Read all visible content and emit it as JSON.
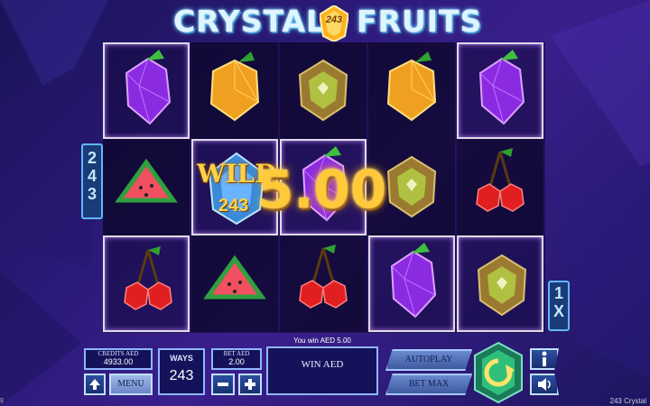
{
  "game": {
    "title_left": "CRYSTAL",
    "title_right": "FRUITS",
    "logo_number": "243",
    "side_ways_label": "243",
    "multiplier_label": "1X",
    "wild_text": "WILD",
    "wild_number": "243",
    "big_win_amount": "5.00",
    "footer_title": "243 Crystal",
    "footer_left": "g"
  },
  "reels": {
    "columns": [
      [
        "plum",
        "watermelon",
        "cherry"
      ],
      [
        "orange",
        "wild",
        "watermelon"
      ],
      [
        "kiwi",
        "plum",
        "cherry"
      ],
      [
        "orange",
        "kiwi",
        "plum"
      ],
      [
        "plum",
        "cherry",
        "kiwi"
      ]
    ],
    "winning_cells": [
      "0-0",
      "4-0",
      "1-1",
      "2-1",
      "0-2",
      "3-2",
      "4-2"
    ]
  },
  "controls": {
    "win_message": "You win AED 5.00",
    "credits_label": "CREDITS AED",
    "credits_value": "4933.00",
    "menu_label": "MENU",
    "ways_label": "WAYS",
    "ways_value": "243",
    "bet_label": "BET AED",
    "bet_value": "2.00",
    "win_label": "WIN AED",
    "autoplay_label": "AUTOPLAY",
    "bet_max_label": "BET MAX",
    "info_icon": "info-icon",
    "sound_icon": "speaker-icon",
    "spin_icon": "spin-arrow-icon",
    "up_icon": "arrow-up-icon",
    "minus_icon": "minus-icon",
    "plus_icon": "plus-icon"
  },
  "colors": {
    "gold": "#ffc93a",
    "panel_bg": "#14125a",
    "panel_border": "#8fb7ff",
    "spin_green": "#2fbf7a"
  }
}
